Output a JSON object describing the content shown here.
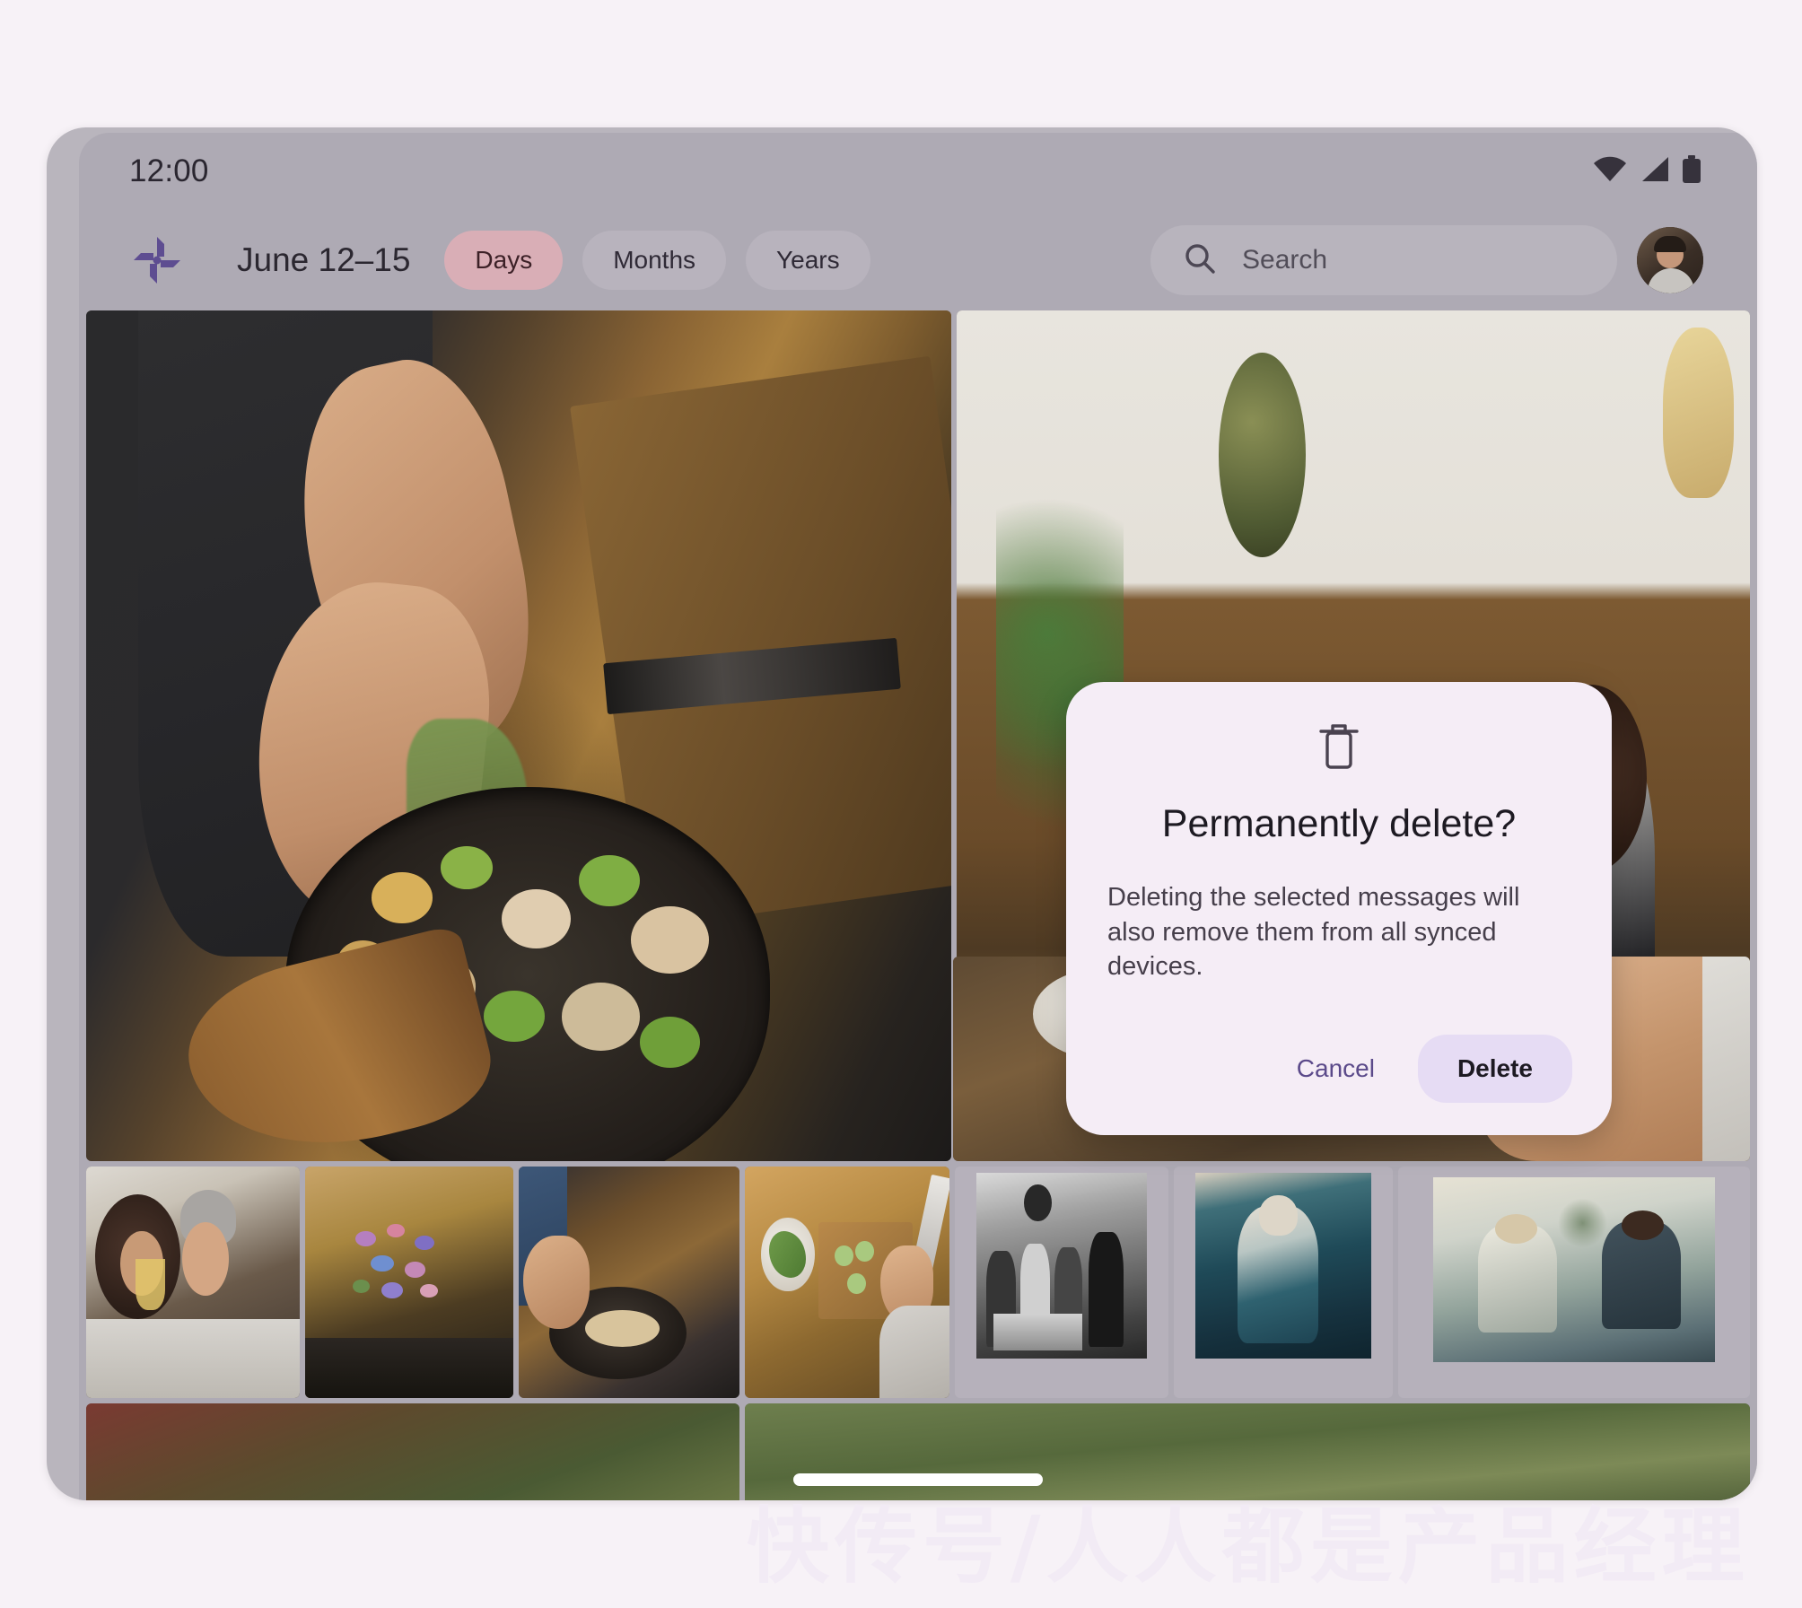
{
  "theme": {
    "page_background": "#f7f2f7",
    "device_bezel": "#b9b5bd",
    "screen_background": "#aeaab4",
    "chip_selected_background": "#d9aeb6",
    "chip_background": "#b8b3bd",
    "dialog_background": "#f5edf6",
    "delete_button_background": "#e6dcf4",
    "cancel_text_color": "#5b4a8a",
    "logo_color": "#5b4a8a"
  },
  "status_bar": {
    "time": "12:00",
    "icons": [
      "wifi-icon",
      "cellular-signal-icon",
      "battery-icon"
    ]
  },
  "top_app_bar": {
    "logo": "photos-pinwheel-logo",
    "date_range": "June 12–15",
    "chips": [
      {
        "label": "Days",
        "selected": true
      },
      {
        "label": "Months",
        "selected": false
      },
      {
        "label": "Years",
        "selected": false
      }
    ],
    "search": {
      "icon": "search-icon",
      "placeholder": "Search",
      "value": ""
    },
    "avatar": "user-avatar"
  },
  "photo_grid": {
    "rows": [
      {
        "tiles": [
          {
            "name": "photo-cooking-herbs",
            "alt": "Person sprinkling herbs over a pan of mushrooms and vegetables"
          },
          {
            "name": "photo-party-group",
            "alt": "Group of friends hiding their faces in a living room"
          }
        ]
      },
      {
        "tiles": [
          {
            "name": "photo-dinner-table",
            "alt": "Dinner table with bottle, bowls and a person reaching in"
          }
        ]
      },
      {
        "tiles": [
          {
            "name": "photo-couple-drinking",
            "alt": "Couple drinking at a table"
          },
          {
            "name": "photo-flower-bouquet",
            "alt": "Wildflower bouquet on a wooden table"
          },
          {
            "name": "photo-skillet-cooking",
            "alt": "Hand holding a skillet with sliced food"
          },
          {
            "name": "photo-cutting-vegetables",
            "alt": "Overhead shot of cucumbers being sliced on a wooden board"
          },
          {
            "name": "photo-polaroid-bw-group",
            "alt": "Black and white polaroid of four people standing by a table"
          },
          {
            "name": "photo-polaroid-teal-person",
            "alt": "Teal toned polaroid of a person sitting in a beanie"
          },
          {
            "name": "photo-polaroid-sepia-pair",
            "alt": "Faded polaroid of two people sitting and talking"
          }
        ]
      },
      {
        "tiles": [
          {
            "name": "photo-rug-outdoors",
            "alt": "Partially visible rug on grass"
          },
          {
            "name": "photo-grass-field",
            "alt": "Partially visible grass field"
          }
        ]
      }
    ]
  },
  "dialog": {
    "icon": "trash-icon",
    "title": "Permanently delete?",
    "body": "Deleting the selected messages will also remove them from all synced devices.",
    "cancel_label": "Cancel",
    "confirm_label": "Delete"
  },
  "gesture_nav": {
    "name": "home-indicator"
  },
  "watermark": {
    "text": "快传号/人人都是产品经理"
  }
}
